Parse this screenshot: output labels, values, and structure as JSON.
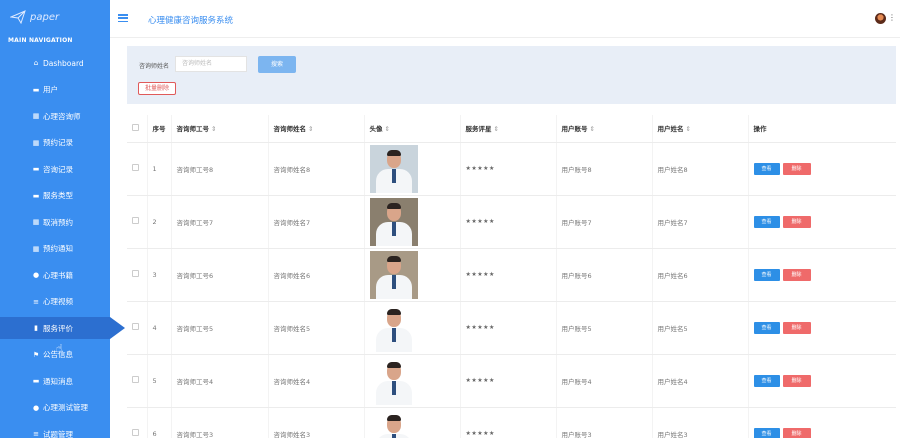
{
  "logo": {
    "text": "paper"
  },
  "sidebar": {
    "section_title": "MAIN NAVIGATION",
    "items": [
      {
        "label": "Dashboard",
        "icon": "home-icon",
        "glyph": "⌂"
      },
      {
        "label": "用户",
        "icon": "user-icon",
        "glyph": "▬"
      },
      {
        "label": "心理咨询师",
        "icon": "grid-icon",
        "glyph": "▦"
      },
      {
        "label": "预约记录",
        "icon": "grid-icon",
        "glyph": "▦"
      },
      {
        "label": "咨询记录",
        "icon": "comment-icon",
        "glyph": "▬"
      },
      {
        "label": "服务类型",
        "icon": "file-icon",
        "glyph": "▬"
      },
      {
        "label": "取消预约",
        "icon": "grid-icon",
        "glyph": "▦"
      },
      {
        "label": "预约通知",
        "icon": "grid-icon",
        "glyph": "▦"
      },
      {
        "label": "心理书籍",
        "icon": "person-icon",
        "glyph": "●"
      },
      {
        "label": "心理视频",
        "icon": "list-icon",
        "glyph": "≡"
      },
      {
        "label": "服务评价",
        "icon": "bar-chart-icon",
        "glyph": "▮"
      },
      {
        "label": "公告信息",
        "icon": "flag-icon",
        "glyph": "⚑"
      },
      {
        "label": "通知消息",
        "icon": "file-icon",
        "glyph": "▬"
      },
      {
        "label": "心理测试管理",
        "icon": "pin-icon",
        "glyph": "●"
      },
      {
        "label": "试题管理",
        "icon": "list-icon",
        "glyph": "≡"
      }
    ],
    "active_index": 10
  },
  "header": {
    "title": "心理健康咨询服务系统"
  },
  "search": {
    "label": "咨询师姓名",
    "placeholder": "咨询师姓名",
    "button": "搜索",
    "batch_delete": "批量删除"
  },
  "table": {
    "headers": [
      "序号",
      "咨询师工号",
      "咨询师姓名",
      "头像",
      "服务评星",
      "用户账号",
      "用户姓名",
      "操作"
    ],
    "rows": [
      {
        "no": "1",
        "counselor_id": "咨询师工号8",
        "counselor_name": "咨询师姓名8",
        "rating": "★★★★★",
        "user_account": "用户账号8",
        "user_name": "用户姓名8",
        "photo_bg": "#c9d4dc"
      },
      {
        "no": "2",
        "counselor_id": "咨询师工号7",
        "counselor_name": "咨询师姓名7",
        "rating": "★★★★★",
        "user_account": "用户账号7",
        "user_name": "用户姓名7",
        "photo_bg": "#8a7f6e"
      },
      {
        "no": "3",
        "counselor_id": "咨询师工号6",
        "counselor_name": "咨询师姓名6",
        "rating": "★★★★★",
        "user_account": "用户账号6",
        "user_name": "用户姓名6",
        "photo_bg": "#a89a86"
      },
      {
        "no": "4",
        "counselor_id": "咨询师工号5",
        "counselor_name": "咨询师姓名5",
        "rating": "★★★★★",
        "user_account": "用户账号5",
        "user_name": "用户姓名5",
        "photo_bg": "#ffffff"
      },
      {
        "no": "5",
        "counselor_id": "咨询师工号4",
        "counselor_name": "咨询师姓名4",
        "rating": "★★★★★",
        "user_account": "用户账号4",
        "user_name": "用户姓名4",
        "photo_bg": "#ffffff"
      },
      {
        "no": "6",
        "counselor_id": "咨询师工号3",
        "counselor_name": "咨询师姓名3",
        "rating": "★★★★★",
        "user_account": "用户账号3",
        "user_name": "用户姓名3",
        "photo_bg": "#ffffff"
      }
    ],
    "view_label": "查看",
    "delete_label": "删除"
  },
  "colors": {
    "accent": "#3a8ef0",
    "danger": "#ef6a6a"
  }
}
